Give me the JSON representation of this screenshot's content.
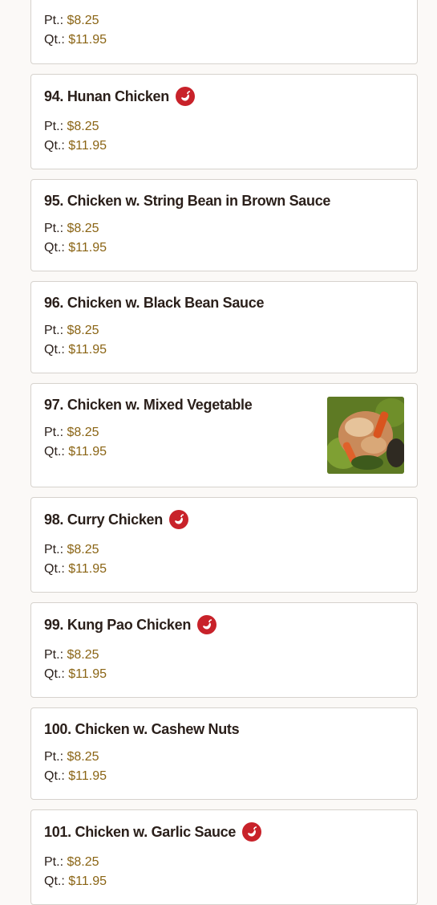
{
  "colors": {
    "spicy": "#c8222a",
    "price": "#8a6414",
    "border": "#d6d2cd"
  },
  "price_labels": {
    "pint": "Pt.:",
    "quart": "Qt.:"
  },
  "items": [
    {
      "title": "",
      "pint": "$8.25",
      "quart": "$11.95",
      "spicy": false
    },
    {
      "title": "94. Hunan Chicken",
      "pint": "$8.25",
      "quart": "$11.95",
      "spicy": true,
      "icon": "chili-pepper-icon"
    },
    {
      "title": "95. Chicken w. String Bean in Brown Sauce",
      "pint": "$8.25",
      "quart": "$11.95",
      "spicy": false
    },
    {
      "title": "96. Chicken w. Black Bean Sauce",
      "pint": "$8.25",
      "quart": "$11.95",
      "spicy": false
    },
    {
      "title": "97. Chicken w. Mixed Vegetable",
      "pint": "$8.25",
      "quart": "$11.95",
      "spicy": false,
      "has_photo": true
    },
    {
      "title": "98. Curry Chicken",
      "pint": "$8.25",
      "quart": "$11.95",
      "spicy": true,
      "icon": "chili-pepper-icon"
    },
    {
      "title": "99. Kung Pao Chicken",
      "pint": "$8.25",
      "quart": "$11.95",
      "spicy": true,
      "icon": "chili-pepper-icon"
    },
    {
      "title": "100. Chicken w. Cashew Nuts",
      "pint": "$8.25",
      "quart": "$11.95",
      "spicy": false
    },
    {
      "title": "101. Chicken w. Garlic Sauce",
      "pint": "$8.25",
      "quart": "$11.95",
      "spicy": true,
      "icon": "chili-pepper-icon"
    }
  ]
}
